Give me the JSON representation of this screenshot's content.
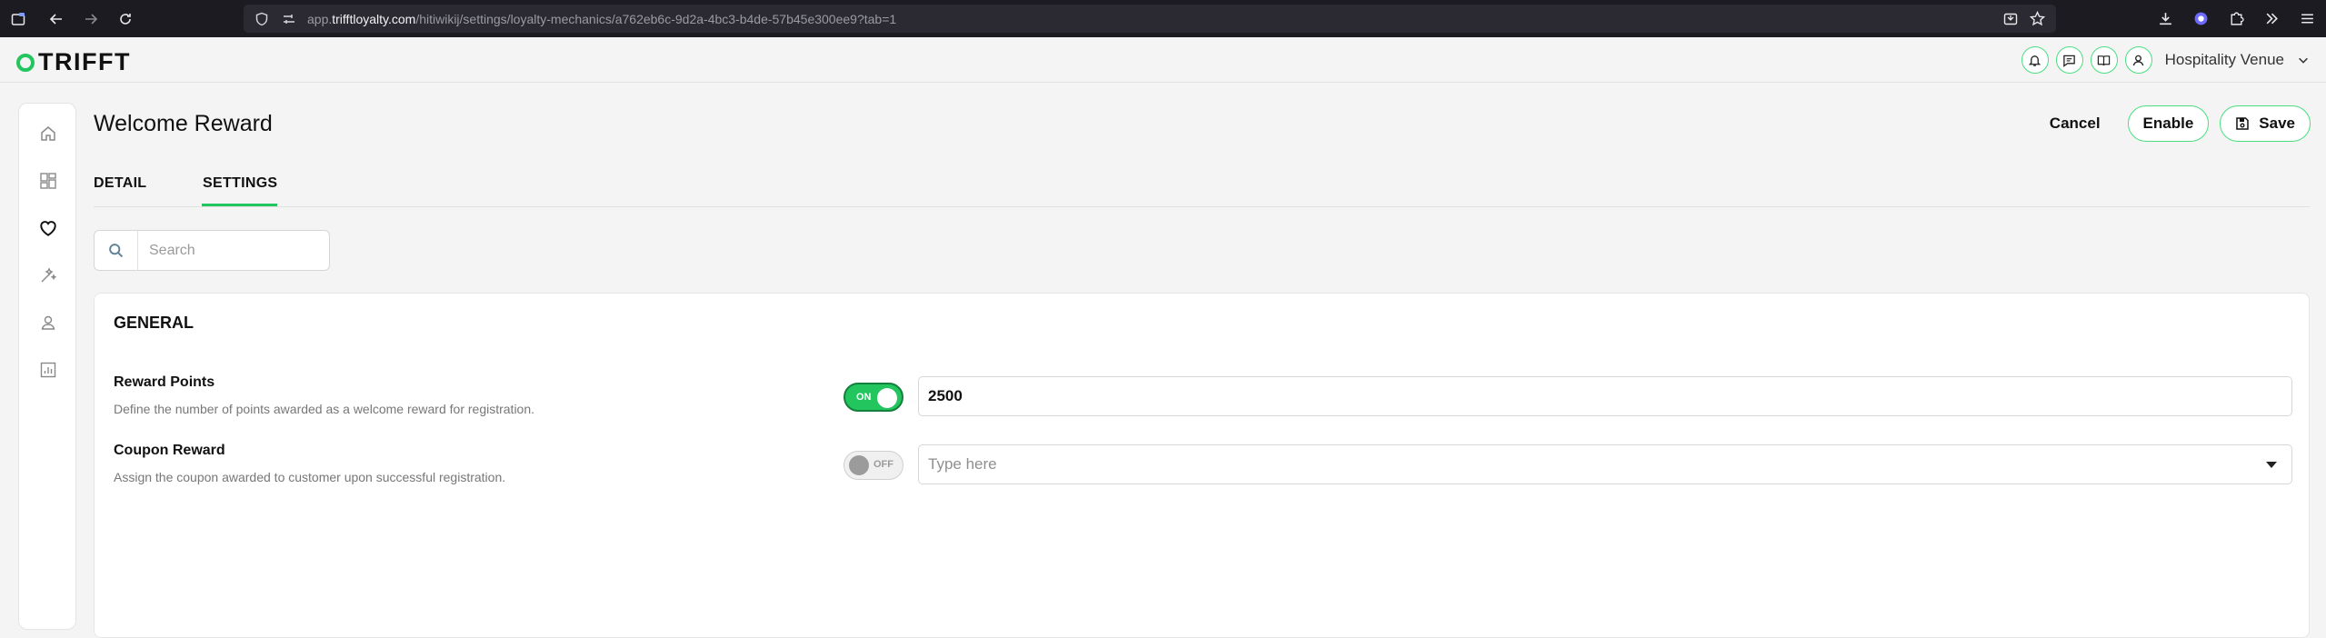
{
  "browser": {
    "url_prefix": "app.",
    "url_host": "trifftloyalty.com",
    "url_path": "/hitiwikij/settings/loyalty-mechanics/a762eb6c-9d2a-4bc3-b4de-57b45e300ee9?tab=1"
  },
  "header": {
    "logo_text": "TRIFFT",
    "venue_label": "Hospitality Venue"
  },
  "page": {
    "title": "Welcome Reward",
    "cancel_label": "Cancel",
    "enable_label": "Enable",
    "save_label": "Save"
  },
  "tabs": [
    {
      "label": "DETAIL",
      "active": false
    },
    {
      "label": "SETTINGS",
      "active": true
    }
  ],
  "search": {
    "placeholder": "Search"
  },
  "general": {
    "title": "GENERAL",
    "rows": [
      {
        "label": "Reward Points",
        "description": "Define the number of points awarded as a welcome reward for registration.",
        "toggle_label": "ON",
        "toggle_on": true,
        "value": "2500"
      },
      {
        "label": "Coupon Reward",
        "description": "Assign the coupon awarded to customer upon successful registration.",
        "toggle_label": "OFF",
        "toggle_on": false,
        "placeholder": "Type here"
      }
    ]
  },
  "colors": {
    "accent": "#22c55e",
    "accent_light": "#4ade80",
    "browser_bg": "#1c1b22"
  }
}
